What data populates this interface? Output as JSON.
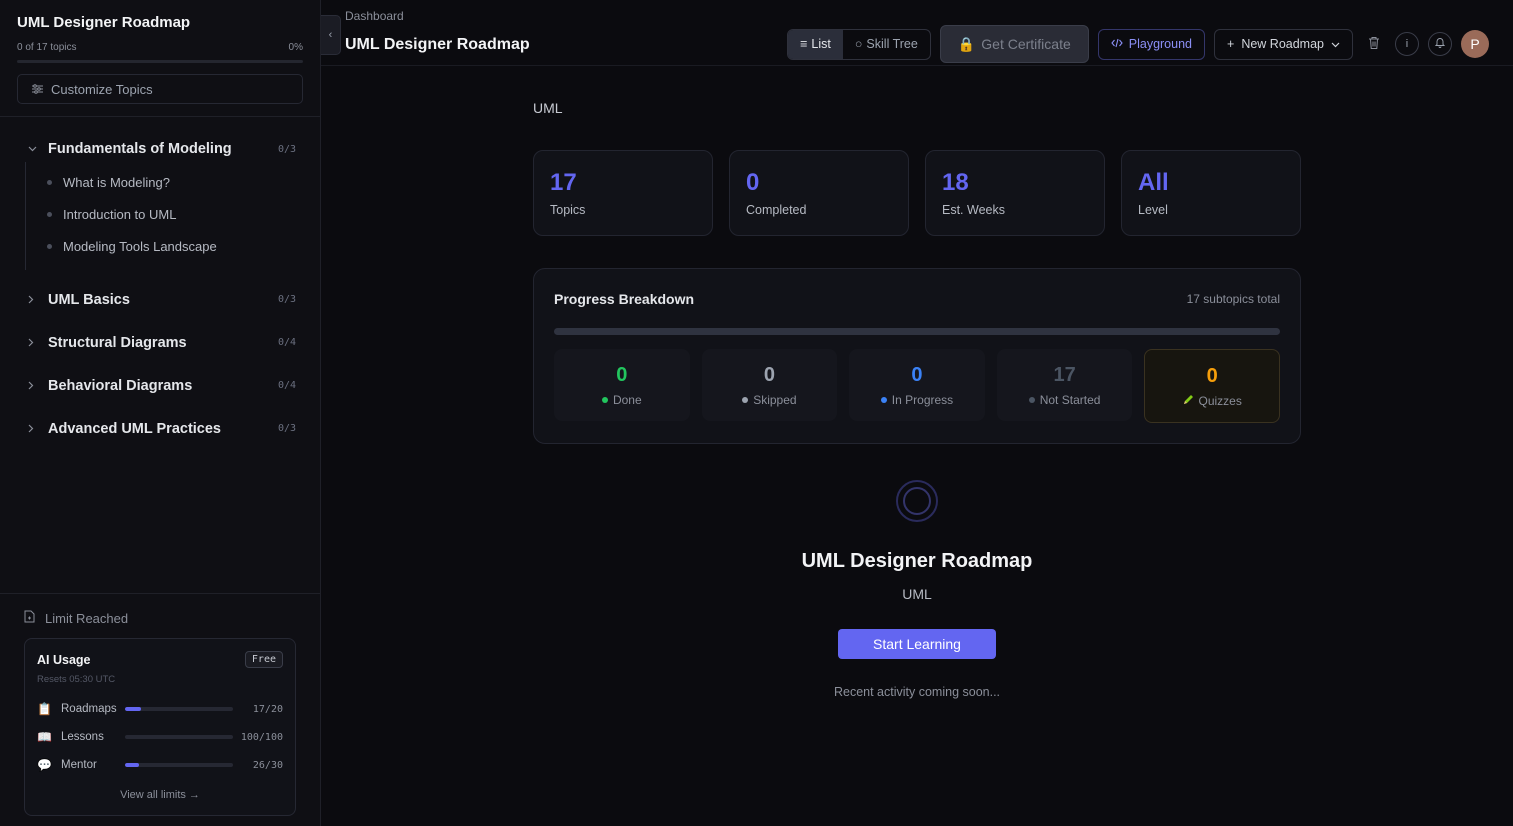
{
  "sidebar": {
    "title": "UML Designer Roadmap",
    "progress_text": "0 of 17 topics",
    "progress_percent_label": "0%",
    "progress_fraction": 0,
    "customize_label": "Customize Topics",
    "modules": [
      {
        "title": "Fundamentals of Modeling",
        "count": "0/3",
        "expanded": true,
        "subtopics": [
          "What is Modeling?",
          "Introduction to UML",
          "Modeling Tools Landscape"
        ]
      },
      {
        "title": "UML Basics",
        "count": "0/3",
        "expanded": false
      },
      {
        "title": "Structural Diagrams",
        "count": "0/4",
        "expanded": false
      },
      {
        "title": "Behavioral Diagrams",
        "count": "0/4",
        "expanded": false
      },
      {
        "title": "Advanced UML Practices",
        "count": "0/3",
        "expanded": false
      }
    ],
    "limit_label": "Limit Reached",
    "ai_usage": {
      "title": "AI Usage",
      "plan_badge": "Free",
      "reset_text": "Resets 05:30 UTC",
      "rows": [
        {
          "icon": "clipboard-icon",
          "label": "Roadmaps",
          "value": "17/20",
          "fill": 0.15
        },
        {
          "icon": "book-icon",
          "label": "Lessons",
          "value": "100/100",
          "fill": 0
        },
        {
          "icon": "chat-bubble-icon",
          "label": "Mentor",
          "value": "26/30",
          "fill": 0.13
        }
      ],
      "view_all": "View all limits →"
    }
  },
  "header": {
    "breadcrumb": "Dashboard",
    "title": "UML Designer Roadmap",
    "view_toggle": {
      "list": "List",
      "skill_tree": "Skill Tree",
      "active": "list"
    },
    "certificate_label": "Get Certificate",
    "playground_label": "Playground",
    "new_roadmap_label": "New Roadmap",
    "avatar_initial": "P"
  },
  "main": {
    "tag": "UML",
    "stats": [
      {
        "value": "17",
        "label": "Topics"
      },
      {
        "value": "0",
        "label": "Completed"
      },
      {
        "value": "18",
        "label": "Est. Weeks"
      },
      {
        "value": "All",
        "label": "Level"
      }
    ],
    "breakdown": {
      "title": "Progress Breakdown",
      "subtitle": "17 subtopics total",
      "items": [
        {
          "value": "0",
          "label": "Done",
          "color": "#22c55e"
        },
        {
          "value": "0",
          "label": "Skipped",
          "color": "#9ca3af"
        },
        {
          "value": "0",
          "label": "In Progress",
          "color": "#3b82f6"
        },
        {
          "value": "17",
          "label": "Not Started",
          "color": "#4b5563"
        },
        {
          "value": "0",
          "label": "Quizzes",
          "color": "#f59e0b"
        }
      ]
    },
    "center_title": "UML Designer Roadmap",
    "center_sub": "UML",
    "start_button": "Start Learning",
    "recent_text": "Recent activity coming soon..."
  },
  "colors": {
    "accent": "#6366f1",
    "background": "#0b0b0f",
    "sidebar": "#0f0f14",
    "done": "#22c55e",
    "in_progress": "#3b82f6",
    "quiz": "#f59e0b"
  }
}
